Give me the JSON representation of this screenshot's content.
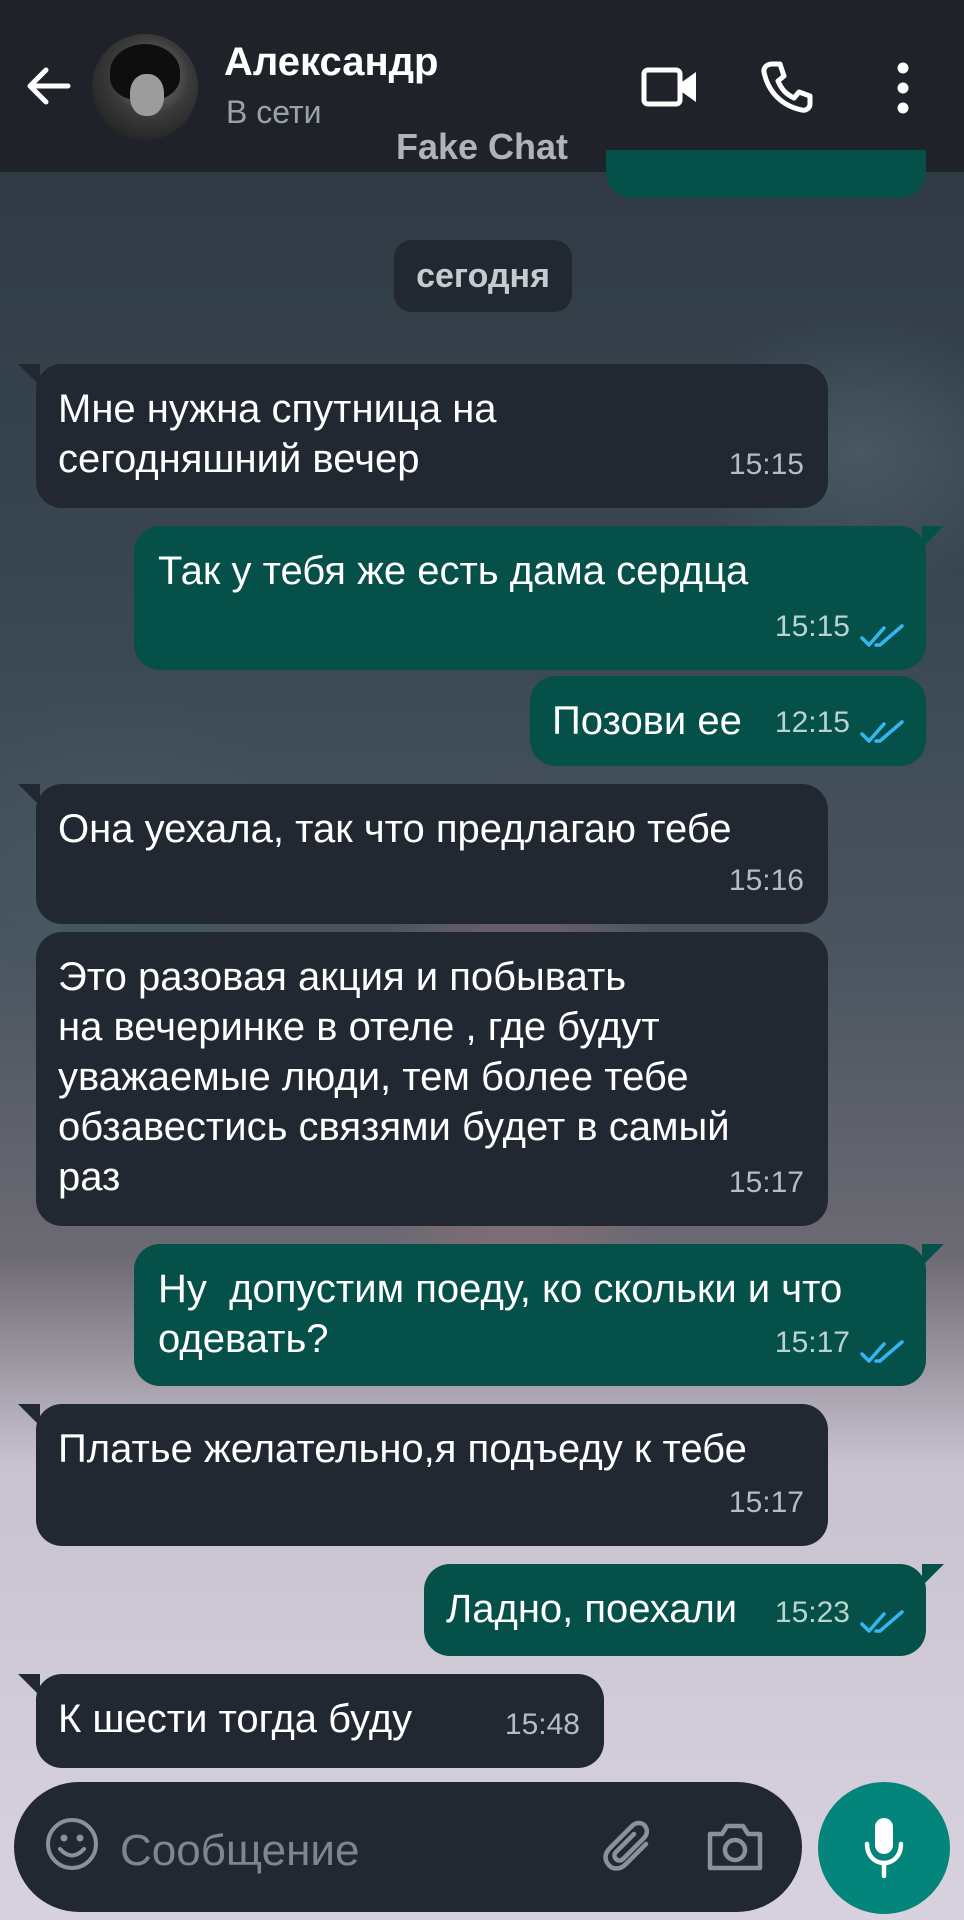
{
  "header": {
    "contact_name": "Александр",
    "status": "В сети",
    "watermark": "Fake Chat"
  },
  "date_divider": "сегодня",
  "messages": [
    {
      "direction": "incoming",
      "text": "Мне нужна спутница на\nсегодняшний вечер",
      "time": "15:15"
    },
    {
      "direction": "outgoing",
      "text": "Так у тебя же есть дама сердца",
      "time": "15:15",
      "read": true
    },
    {
      "direction": "outgoing",
      "text": "Позови ее",
      "time": "12:15",
      "read": true
    },
    {
      "direction": "incoming",
      "text": "Она уехала, так что предлагаю тебе",
      "time": "15:16"
    },
    {
      "direction": "incoming",
      "text": "Это разовая акция и побывать\nна вечеринке в отеле , где будут\nуважаемые люди, тем более тебе\nобзавестись связями будет в самый\nраз",
      "time": "15:17"
    },
    {
      "direction": "outgoing",
      "text": "Ну  допустим поеду, ко скольки и что\nодевать?",
      "time": "15:17",
      "read": true
    },
    {
      "direction": "incoming",
      "text": "Платье желательно,я подъеду к тебе",
      "time": "15:17"
    },
    {
      "direction": "outgoing",
      "text": "Ладно, поехали",
      "time": "15:23",
      "read": true
    },
    {
      "direction": "incoming",
      "text": "К шести тогда буду",
      "time": "15:48"
    }
  ],
  "input": {
    "placeholder": "Сообщение",
    "value": ""
  },
  "colors": {
    "header_bg": "#1f2329",
    "incoming_bubble": "#222831",
    "outgoing_bubble": "#055048",
    "read_ticks": "#34b7f1",
    "mic_button": "#03857c"
  },
  "icons": [
    "back-arrow-icon",
    "video-call-icon",
    "phone-icon",
    "more-vert-icon",
    "emoji-icon",
    "attach-icon",
    "camera-icon",
    "mic-icon"
  ]
}
